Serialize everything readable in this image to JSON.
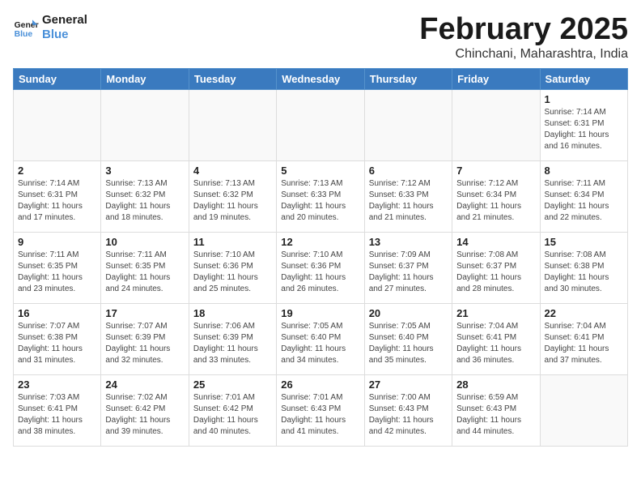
{
  "header": {
    "logo_line1": "General",
    "logo_line2": "Blue",
    "title": "February 2025",
    "subtitle": "Chinchani, Maharashtra, India"
  },
  "weekdays": [
    "Sunday",
    "Monday",
    "Tuesday",
    "Wednesday",
    "Thursday",
    "Friday",
    "Saturday"
  ],
  "weeks": [
    [
      {
        "day": "",
        "info": ""
      },
      {
        "day": "",
        "info": ""
      },
      {
        "day": "",
        "info": ""
      },
      {
        "day": "",
        "info": ""
      },
      {
        "day": "",
        "info": ""
      },
      {
        "day": "",
        "info": ""
      },
      {
        "day": "1",
        "info": "Sunrise: 7:14 AM\nSunset: 6:31 PM\nDaylight: 11 hours\nand 16 minutes."
      }
    ],
    [
      {
        "day": "2",
        "info": "Sunrise: 7:14 AM\nSunset: 6:31 PM\nDaylight: 11 hours\nand 17 minutes."
      },
      {
        "day": "3",
        "info": "Sunrise: 7:13 AM\nSunset: 6:32 PM\nDaylight: 11 hours\nand 18 minutes."
      },
      {
        "day": "4",
        "info": "Sunrise: 7:13 AM\nSunset: 6:32 PM\nDaylight: 11 hours\nand 19 minutes."
      },
      {
        "day": "5",
        "info": "Sunrise: 7:13 AM\nSunset: 6:33 PM\nDaylight: 11 hours\nand 20 minutes."
      },
      {
        "day": "6",
        "info": "Sunrise: 7:12 AM\nSunset: 6:33 PM\nDaylight: 11 hours\nand 21 minutes."
      },
      {
        "day": "7",
        "info": "Sunrise: 7:12 AM\nSunset: 6:34 PM\nDaylight: 11 hours\nand 21 minutes."
      },
      {
        "day": "8",
        "info": "Sunrise: 7:11 AM\nSunset: 6:34 PM\nDaylight: 11 hours\nand 22 minutes."
      }
    ],
    [
      {
        "day": "9",
        "info": "Sunrise: 7:11 AM\nSunset: 6:35 PM\nDaylight: 11 hours\nand 23 minutes."
      },
      {
        "day": "10",
        "info": "Sunrise: 7:11 AM\nSunset: 6:35 PM\nDaylight: 11 hours\nand 24 minutes."
      },
      {
        "day": "11",
        "info": "Sunrise: 7:10 AM\nSunset: 6:36 PM\nDaylight: 11 hours\nand 25 minutes."
      },
      {
        "day": "12",
        "info": "Sunrise: 7:10 AM\nSunset: 6:36 PM\nDaylight: 11 hours\nand 26 minutes."
      },
      {
        "day": "13",
        "info": "Sunrise: 7:09 AM\nSunset: 6:37 PM\nDaylight: 11 hours\nand 27 minutes."
      },
      {
        "day": "14",
        "info": "Sunrise: 7:08 AM\nSunset: 6:37 PM\nDaylight: 11 hours\nand 28 minutes."
      },
      {
        "day": "15",
        "info": "Sunrise: 7:08 AM\nSunset: 6:38 PM\nDaylight: 11 hours\nand 30 minutes."
      }
    ],
    [
      {
        "day": "16",
        "info": "Sunrise: 7:07 AM\nSunset: 6:38 PM\nDaylight: 11 hours\nand 31 minutes."
      },
      {
        "day": "17",
        "info": "Sunrise: 7:07 AM\nSunset: 6:39 PM\nDaylight: 11 hours\nand 32 minutes."
      },
      {
        "day": "18",
        "info": "Sunrise: 7:06 AM\nSunset: 6:39 PM\nDaylight: 11 hours\nand 33 minutes."
      },
      {
        "day": "19",
        "info": "Sunrise: 7:05 AM\nSunset: 6:40 PM\nDaylight: 11 hours\nand 34 minutes."
      },
      {
        "day": "20",
        "info": "Sunrise: 7:05 AM\nSunset: 6:40 PM\nDaylight: 11 hours\nand 35 minutes."
      },
      {
        "day": "21",
        "info": "Sunrise: 7:04 AM\nSunset: 6:41 PM\nDaylight: 11 hours\nand 36 minutes."
      },
      {
        "day": "22",
        "info": "Sunrise: 7:04 AM\nSunset: 6:41 PM\nDaylight: 11 hours\nand 37 minutes."
      }
    ],
    [
      {
        "day": "23",
        "info": "Sunrise: 7:03 AM\nSunset: 6:41 PM\nDaylight: 11 hours\nand 38 minutes."
      },
      {
        "day": "24",
        "info": "Sunrise: 7:02 AM\nSunset: 6:42 PM\nDaylight: 11 hours\nand 39 minutes."
      },
      {
        "day": "25",
        "info": "Sunrise: 7:01 AM\nSunset: 6:42 PM\nDaylight: 11 hours\nand 40 minutes."
      },
      {
        "day": "26",
        "info": "Sunrise: 7:01 AM\nSunset: 6:43 PM\nDaylight: 11 hours\nand 41 minutes."
      },
      {
        "day": "27",
        "info": "Sunrise: 7:00 AM\nSunset: 6:43 PM\nDaylight: 11 hours\nand 42 minutes."
      },
      {
        "day": "28",
        "info": "Sunrise: 6:59 AM\nSunset: 6:43 PM\nDaylight: 11 hours\nand 44 minutes."
      },
      {
        "day": "",
        "info": ""
      }
    ]
  ]
}
